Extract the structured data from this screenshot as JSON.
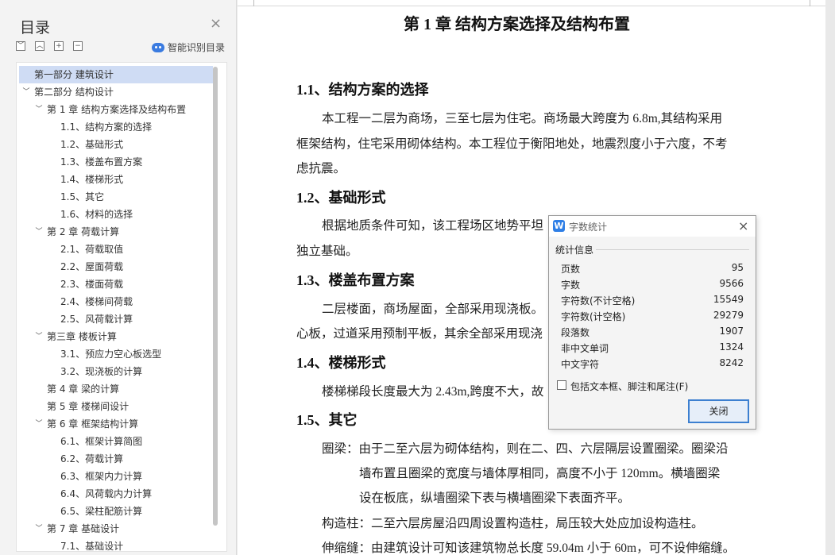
{
  "sidebar": {
    "title": "目录",
    "close_icon": "×",
    "ai_button_label": "智能识别目录",
    "controls": [
      "collapse-all",
      "expand-level",
      "add-item",
      "remove-item"
    ],
    "items": [
      {
        "label": "第一部分  建筑设计",
        "level": 1,
        "arrow": "",
        "selected": true
      },
      {
        "label": "第二部分  结构设计",
        "level": 1,
        "arrow": "﹀"
      },
      {
        "label": "第 1 章  结构方案选择及结构布置",
        "level": 2,
        "arrow": "﹀"
      },
      {
        "label": "1.1、结构方案的选择",
        "level": 3
      },
      {
        "label": "1.2、基础形式",
        "level": 3
      },
      {
        "label": "1.3、楼盖布置方案",
        "level": 3
      },
      {
        "label": "1.4、楼梯形式",
        "level": 3
      },
      {
        "label": "1.5、其它",
        "level": 3
      },
      {
        "label": "1.6、材料的选择",
        "level": 3
      },
      {
        "label": "第 2 章  荷载计算",
        "level": 2,
        "arrow": "﹀"
      },
      {
        "label": "2.1、荷载取值",
        "level": 3
      },
      {
        "label": "2.2、屋面荷载",
        "level": 3
      },
      {
        "label": "2.3、楼面荷载",
        "level": 3
      },
      {
        "label": "2.4、楼梯间荷载",
        "level": 3
      },
      {
        "label": "2.5、风荷载计算",
        "level": 3
      },
      {
        "label": "第三章  楼板计算",
        "level": 2,
        "arrow": "﹀"
      },
      {
        "label": "3.1、预应力空心板选型",
        "level": 3
      },
      {
        "label": "3.2、现浇板的计算",
        "level": 3
      },
      {
        "label": "第 4 章    梁的计算",
        "level": 2,
        "arrow": ""
      },
      {
        "label": "第 5 章  楼梯间设计",
        "level": 2,
        "arrow": ""
      },
      {
        "label": "第 6 章  框架结构计算",
        "level": 2,
        "arrow": "﹀"
      },
      {
        "label": "6.1、框架计算简图",
        "level": 3
      },
      {
        "label": "6.2、荷载计算",
        "level": 3
      },
      {
        "label": "6.3、框架内力计算",
        "level": 3
      },
      {
        "label": "6.4、风荷载内力计算",
        "level": 3
      },
      {
        "label": "6.5、梁柱配筋计算",
        "level": 3
      },
      {
        "label": "第 7 章    基础设计",
        "level": 2,
        "arrow": "﹀"
      },
      {
        "label": "7.1、基础设计",
        "level": 3
      }
    ]
  },
  "document": {
    "chapter_title": "第 1 章  结构方案选择及结构布置",
    "s1_title": "1.1、结构方案的选择",
    "s1_p1": "本工程一二层为商场，三至七层为住宅。商场最大跨度为 6.8m,其结构采用",
    "s1_p2": "框架结构，住宅采用砌体结构。本工程位于衡阳地处，地震烈度小于六度，不考",
    "s1_p3": "虑抗震。",
    "s2_title": "1.2、基础形式",
    "s2_p1": "根据地质条件可知，该工程场区地势平坦",
    "s2_p2": "独立基础。",
    "s3_title": "1.3、楼盖布置方案",
    "s3_p1": "二层楼面，商场屋面，全部采用现浇板。",
    "s3_p2": "心板，过道采用预制平板，其余全部采用现浇",
    "s4_title": "1.4、楼梯形式",
    "s4_p1": "楼梯梯段长度最大为 2.43m,跨度不大，故",
    "s5_title": "1.5、其它",
    "s5_p1": "圈梁：由于二至六层为砌体结构，则在二、四、六层隔层设置圈梁。圈梁沿",
    "s5_p2": "墙布置且圈梁的宽度与墙体厚相同，高度不小于 120mm。横墙圈梁",
    "s5_p3": "设在板底，纵墙圈梁下表与横墙圈梁下表面齐平。",
    "s5_p4": "构造柱：二至六层房屋沿四周设置构造柱，局压较大处应加设构造柱。",
    "s5_p5": "伸缩缝：由建筑设计可知该建筑物总长度 59.04m 小于 60m，可不设伸缩缝。"
  },
  "dialog": {
    "title": "字数统计",
    "app_icon": "W",
    "close_icon": "×",
    "group_label": "统计信息",
    "stats": [
      {
        "key": "页数",
        "value": "95"
      },
      {
        "key": "字数",
        "value": "9566"
      },
      {
        "key": "字符数(不计空格)",
        "value": "15549"
      },
      {
        "key": "字符数(计空格)",
        "value": "29279"
      },
      {
        "key": "段落数",
        "value": "1907"
      },
      {
        "key": "非中文单词",
        "value": "1324"
      },
      {
        "key": "中文字符",
        "value": "8242"
      }
    ],
    "checkbox_label": "包括文本框、脚注和尾注(F)",
    "checkbox_checked": false,
    "close_button": "关闭"
  },
  "colors": {
    "selected_bg": "#cfdcf4",
    "accent": "#3c7fd0",
    "wps_icon": "#2f7fe6"
  }
}
